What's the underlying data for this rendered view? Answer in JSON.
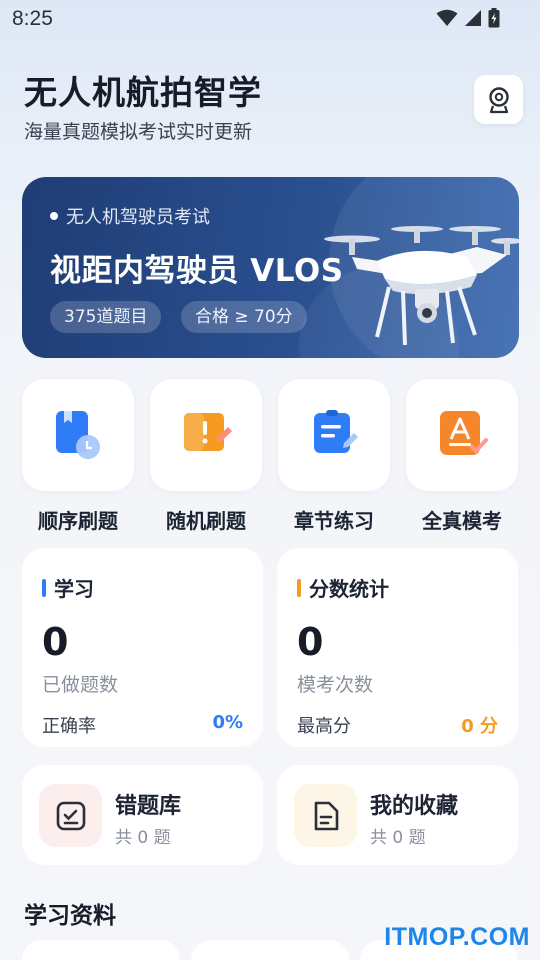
{
  "status": {
    "time": "8:25"
  },
  "header": {
    "title": "无人机航拍智学",
    "subtitle": "海量真题模拟考试实时更新",
    "profile_icon": "user-badge-icon"
  },
  "banner": {
    "tag": "无人机驾驶员考试",
    "title": "视距内驾驶员 VLOS",
    "pills": [
      "375道题目",
      "合格 ≥ 70分"
    ]
  },
  "quick_actions": [
    {
      "label": "顺序刷题",
      "icon": "sequential-book-icon",
      "color": "#2f7df6"
    },
    {
      "label": "随机刷题",
      "icon": "random-book-icon",
      "color": "#f59a23"
    },
    {
      "label": "章节练习",
      "icon": "chapter-note-icon",
      "color": "#2f7df6"
    },
    {
      "label": "全真模考",
      "icon": "mock-exam-icon",
      "color": "#f5862a"
    }
  ],
  "stats": {
    "study": {
      "title": "学习",
      "value": "0",
      "caption": "已做题数",
      "sub_label": "正确率",
      "sub_value": "0%",
      "accent": "#2f7df6"
    },
    "score": {
      "title": "分数统计",
      "value": "0",
      "caption": "模考次数",
      "sub_label": "最高分",
      "sub_value": "0 分",
      "accent": "#f59a23"
    }
  },
  "library": {
    "wrong": {
      "title": "错题库",
      "count": "共 0 题",
      "icon": "wrong-list-icon"
    },
    "favorites": {
      "title": "我的收藏",
      "count": "共 0 题",
      "icon": "favorite-doc-icon"
    }
  },
  "section": {
    "title": "学习资料"
  },
  "watermark": "ITMOP.COM"
}
